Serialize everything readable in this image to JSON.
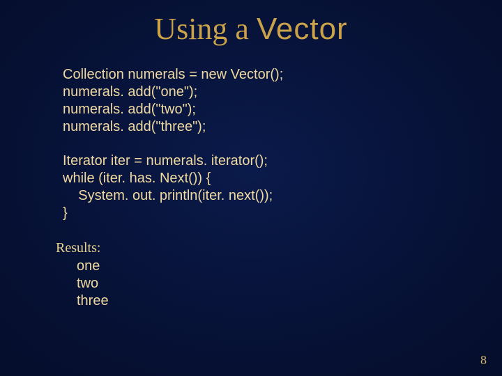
{
  "title": {
    "part1": "Using a ",
    "part2": "Vector"
  },
  "code_block_1": "Collection numerals = new Vector();\nnumerals. add(\"one\");\nnumerals. add(\"two\");\nnumerals. add(\"three\");",
  "code_block_2": "Iterator iter = numerals. iterator();\nwhile (iter. has. Next()) {\n    System. out. println(iter. next());\n}",
  "results_label": "Results:",
  "results_output": "one\ntwo\nthree",
  "page_number": "8"
}
